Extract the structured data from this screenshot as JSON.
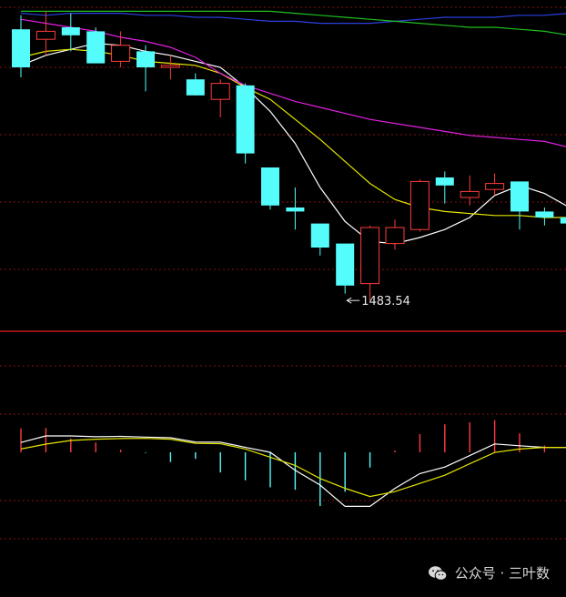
{
  "chart_data": {
    "type": "candlestick",
    "panels": [
      {
        "name": "price",
        "annotation": {
          "label": "1483.54",
          "arrow": "←",
          "candle_index": 13,
          "price": 1483.54
        },
        "candles": [
          {
            "open": 1619,
            "high": 1626,
            "low": 1595,
            "close": 1600
          },
          {
            "open": 1614,
            "high": 1628,
            "low": 1606,
            "close": 1618
          },
          {
            "open": 1620,
            "high": 1627,
            "low": 1608,
            "close": 1616
          },
          {
            "open": 1618,
            "high": 1620,
            "low": 1602,
            "close": 1602
          },
          {
            "open": 1603,
            "high": 1618,
            "low": 1600,
            "close": 1611
          },
          {
            "open": 1608,
            "high": 1611,
            "low": 1588,
            "close": 1600
          },
          {
            "open": 1600,
            "high": 1606,
            "low": 1594,
            "close": 1601
          },
          {
            "open": 1594,
            "high": 1597,
            "low": 1586,
            "close": 1586
          },
          {
            "open": 1584,
            "high": 1594,
            "low": 1575,
            "close": 1592
          },
          {
            "open": 1591,
            "high": 1592,
            "low": 1552,
            "close": 1557
          },
          {
            "open": 1550,
            "high": 1550,
            "low": 1529,
            "close": 1531
          },
          {
            "open": 1530,
            "high": 1540,
            "low": 1519,
            "close": 1528
          },
          {
            "open": 1522,
            "high": 1522,
            "low": 1506,
            "close": 1510
          },
          {
            "open": 1512,
            "high": 1512,
            "low": 1487,
            "close": 1491
          },
          {
            "open": 1492,
            "high": 1521,
            "low": 1483.54,
            "close": 1520
          },
          {
            "open": 1512,
            "high": 1524,
            "low": 1509,
            "close": 1520
          },
          {
            "open": 1519,
            "high": 1544,
            "low": 1518,
            "close": 1543
          },
          {
            "open": 1545,
            "high": 1548,
            "low": 1532,
            "close": 1541
          },
          {
            "open": 1535,
            "high": 1546,
            "low": 1531,
            "close": 1538
          },
          {
            "open": 1539,
            "high": 1547,
            "low": 1536,
            "close": 1542
          },
          {
            "open": 1543,
            "high": 1543,
            "low": 1519,
            "close": 1528
          },
          {
            "open": 1528,
            "high": 1530,
            "low": 1521,
            "close": 1525
          },
          {
            "open": 1525,
            "high": 1527,
            "low": 1516,
            "close": 1522
          }
        ],
        "lines": [
          {
            "color": "#ffffff",
            "values": [
              1601,
              1606,
              1609,
              1612,
              1611,
              1608,
              1606,
              1603,
              1600,
              1590,
              1578,
              1562,
              1540,
              1523,
              1513,
              1512,
              1515,
              1519,
              1525,
              1536,
              1541,
              1537,
              1530
            ]
          },
          {
            "color": "#e6e600",
            "values": [
              1605,
              1608,
              1609,
              1608,
              1606,
              1603,
              1602,
              1601,
              1597,
              1590,
              1584,
              1574,
              1564,
              1553,
              1542,
              1534,
              1530,
              1528,
              1527,
              1526,
              1526,
              1525,
              1525
            ]
          },
          {
            "color": "#e020e0",
            "values": [
              1624,
              1622,
              1620,
              1618,
              1615,
              1613,
              1610,
              1605,
              1597,
              1591,
              1587,
              1583,
              1580,
              1577,
              1574,
              1572,
              1570,
              1568,
              1566,
              1565,
              1564,
              1563,
              1560
            ]
          },
          {
            "color": "#2a40e0",
            "values": [
              1627,
              1626,
              1627,
              1627,
              1627,
              1626,
              1626,
              1625,
              1625,
              1624,
              1623,
              1623,
              1622,
              1622,
              1622,
              1623,
              1624,
              1625,
              1625,
              1625,
              1626,
              1626,
              1627
            ]
          },
          {
            "color": "#20c020",
            "values": [
              1628,
              1628,
              1628,
              1628,
              1628,
              1628,
              1628,
              1628,
              1628,
              1628,
              1628,
              1627,
              1626,
              1625,
              1624,
              1623,
              1622,
              1621,
              1620,
              1620,
              1619,
              1618,
              1616
            ]
          }
        ]
      },
      {
        "name": "macd",
        "histogram": [
          1.46,
          1.49,
          0.83,
          0.6,
          0.17,
          -0.04,
          -0.59,
          -0.4,
          -1.23,
          -1.71,
          -2.14,
          -2.29,
          -3.28,
          -2.41,
          -0.93,
          0.11,
          1.11,
          1.71,
          1.83,
          1.96,
          1.16,
          0.42,
          0.11
        ],
        "lines": [
          {
            "color": "#ffffff",
            "values": [
              0.6,
              1.0,
              1.0,
              0.95,
              0.97,
              0.93,
              0.89,
              0.63,
              0.62,
              0.3,
              0.0,
              -1.1,
              -2.0,
              -3.3,
              -3.3,
              -2.2,
              -1.3,
              -0.9,
              -0.2,
              0.51,
              0.4,
              0.3,
              0.3
            ]
          },
          {
            "color": "#e6e600",
            "values": [
              0.2,
              0.5,
              0.72,
              0.8,
              0.84,
              0.85,
              0.8,
              0.55,
              0.53,
              0.2,
              -0.3,
              -0.8,
              -1.6,
              -2.2,
              -2.7,
              -2.4,
              -1.9,
              -1.4,
              -0.7,
              -0.01,
              0.2,
              0.3,
              0.3
            ]
          }
        ]
      }
    ]
  },
  "watermark": {
    "label": "公众号 · 三叶数",
    "icon": "wechat-icon"
  }
}
